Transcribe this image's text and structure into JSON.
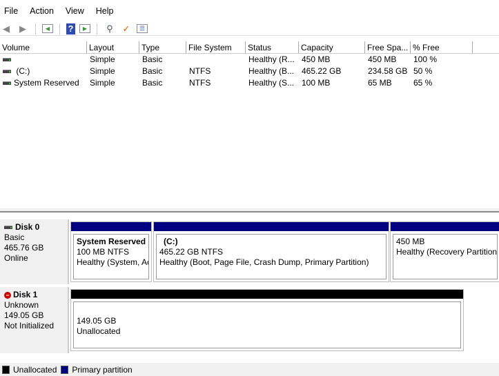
{
  "menu": [
    "File",
    "Action",
    "View",
    "Help"
  ],
  "toolbar": [
    "back-icon",
    "forward-icon",
    "console-tree-icon",
    "help-icon",
    "action-pane-icon",
    "connect-disk-icon",
    "properties-icon",
    "checklist-icon"
  ],
  "table": {
    "headers": [
      "Volume",
      "Layout",
      "Type",
      "File System",
      "Status",
      "Capacity",
      "Free Spa...",
      "% Free"
    ],
    "rows": [
      [
        "",
        "Simple",
        "Basic",
        "",
        "Healthy (R...",
        "450 MB",
        "450 MB",
        "100 %"
      ],
      [
        " (C:)",
        "Simple",
        "Basic",
        "NTFS",
        "Healthy (B...",
        "465.22 GB",
        "234.58 GB",
        "50 %"
      ],
      [
        "System Reserved",
        "Simple",
        "Basic",
        "NTFS",
        "Healthy (S...",
        "100 MB",
        "65 MB",
        "65 %"
      ]
    ]
  },
  "disks": [
    {
      "name": "Disk 0",
      "type": "Basic",
      "size": "465.76 GB",
      "status": "Online",
      "partitions": [
        {
          "name": "System Reserved",
          "size": "100 MB NTFS",
          "status": "Healthy (System, Ac"
        },
        {
          "name": "(C:)",
          "size": "465.22 GB NTFS",
          "status": "Healthy (Boot, Page File, Crash Dump, Primary Partition)"
        },
        {
          "name": "",
          "size": "450 MB",
          "status": "Healthy (Recovery Partition)"
        }
      ]
    },
    {
      "name": "Disk 1",
      "type": "Unknown",
      "size": "149.05 GB",
      "status": "Not Initialized",
      "partitions": [
        {
          "size": "149.05 GB",
          "status": "Unallocated"
        }
      ]
    }
  ],
  "legend": [
    {
      "label": "Unallocated",
      "color": "#000000"
    },
    {
      "label": "Primary partition",
      "color": "#000080"
    }
  ]
}
